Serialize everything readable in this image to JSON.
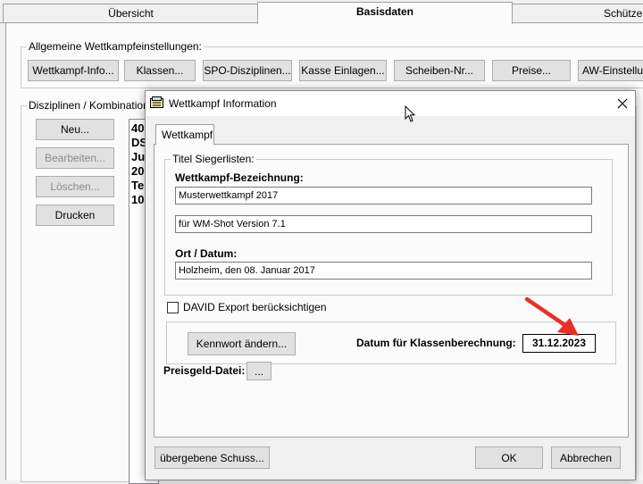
{
  "tabs": [
    "Übersicht",
    "Basisdaten",
    "Schützen"
  ],
  "general_settings": {
    "label": "Allgemeine Wettkampfeinstellungen:",
    "buttons": [
      "Wettkampf-Info...",
      "Klassen...",
      "SPO-Disziplinen...",
      "Kasse Einlagen...",
      "Scheiben-Nr...",
      "Preise...",
      "AW-Einstellung"
    ]
  },
  "disciplines": {
    "label": "Disziplinen / Kombinationen",
    "buttons": {
      "new": "Neu...",
      "edit": "Bearbeiten...",
      "delete": "Löschen...",
      "print": "Drucken"
    },
    "list_items": [
      "40",
      "DS",
      "Ju",
      "20",
      "Te",
      "10"
    ]
  },
  "dialog": {
    "title": "Wettkampf Information",
    "tab": "Wettkampf",
    "group_label": "Titel Siegerlisten:",
    "name_label": "Wettkampf-Bezeichnung:",
    "name_value": "Musterwettkampf 2017",
    "subtitle_value": "für WM-Shot Version 7.1",
    "place_label": "Ort / Datum:",
    "place_value": "Holzheim, den 08. Januar 2017",
    "david_label": "DAVID Export berücksichtigen",
    "password_button": "Kennwort ändern...",
    "class_date_label": "Datum für Klassenberechnung:",
    "class_date_value": "31.12.2023",
    "prize_file_label": "Preisgeld-Datei:",
    "prize_file_button": "...",
    "shots_button": "übergebene Schuss...",
    "ok_button": "OK",
    "cancel_button": "Abbrechen"
  },
  "colors": {
    "focus_blue": "#0078d7",
    "annotation_arrow": "#e8302a"
  }
}
